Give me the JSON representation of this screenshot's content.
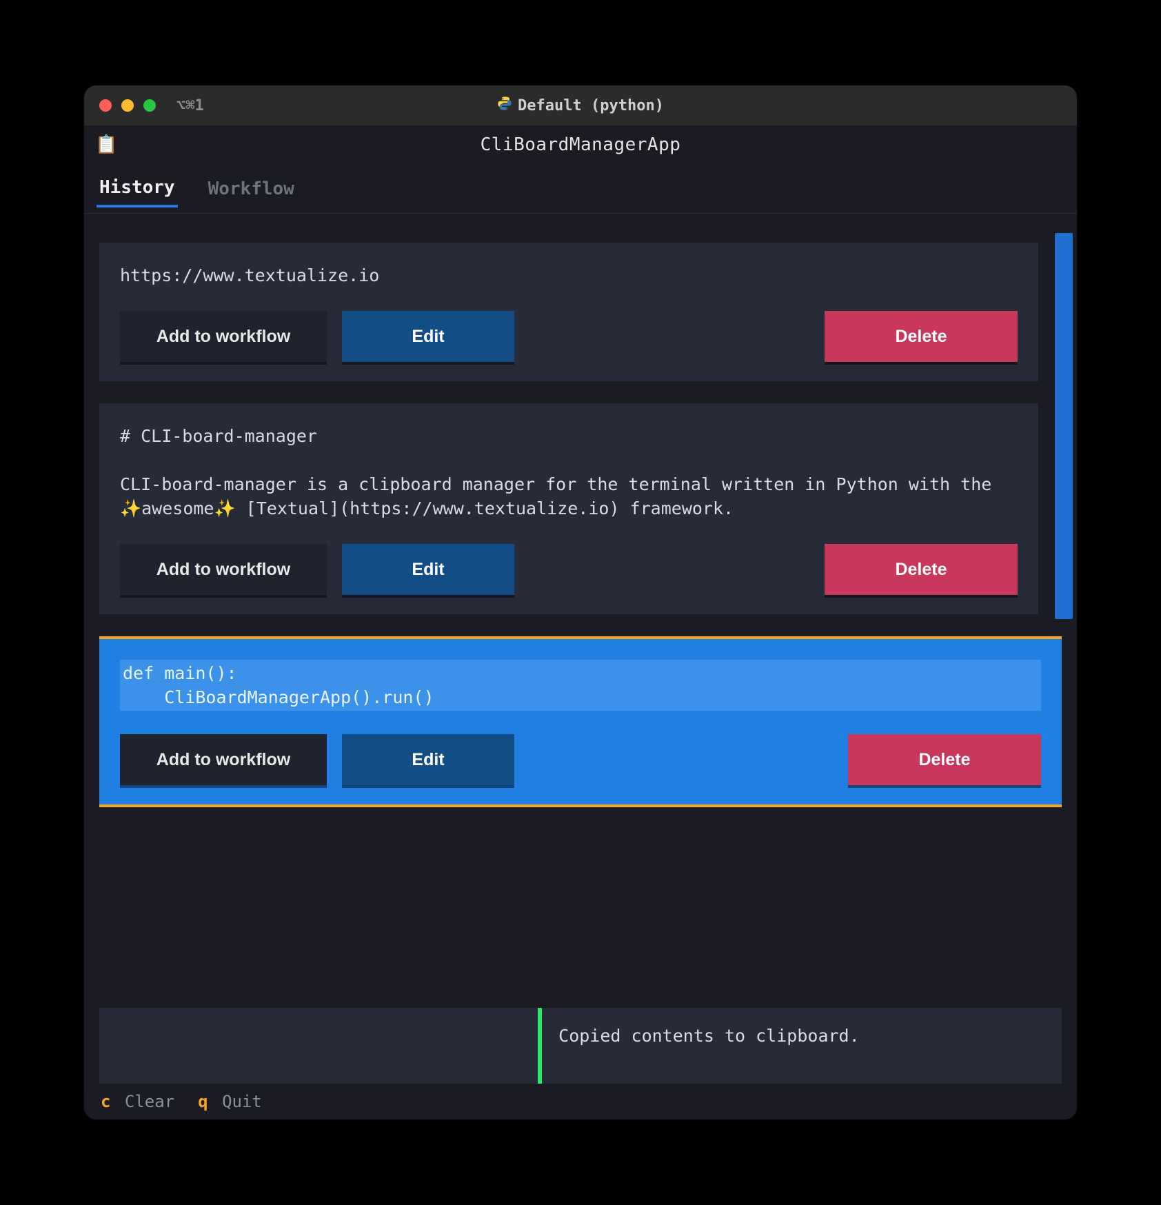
{
  "window": {
    "hint": "⌥⌘1",
    "title": "Default (python)"
  },
  "app": {
    "icon": "📋",
    "title": "CliBoardManagerApp"
  },
  "tabs": [
    {
      "id": "history",
      "label": "History",
      "active": true
    },
    {
      "id": "workflow",
      "label": "Workflow",
      "active": false
    }
  ],
  "buttons": {
    "add": "Add to workflow",
    "edit": "Edit",
    "delete": "Delete"
  },
  "entries": [
    {
      "selected": false,
      "text": "https://www.textualize.io"
    },
    {
      "selected": false,
      "text": "# CLI-board-manager\n\nCLI-board-manager is a clipboard manager for the terminal written in Python with the ✨awesome✨ [Textual](https://www.textualize.io) framework."
    },
    {
      "selected": true,
      "text": "def main():\n    CliBoardManagerApp().run()"
    }
  ],
  "toast": "Copied contents to clipboard.",
  "footer": [
    {
      "key": "c",
      "label": "Clear"
    },
    {
      "key": "q",
      "label": "Quit"
    }
  ]
}
